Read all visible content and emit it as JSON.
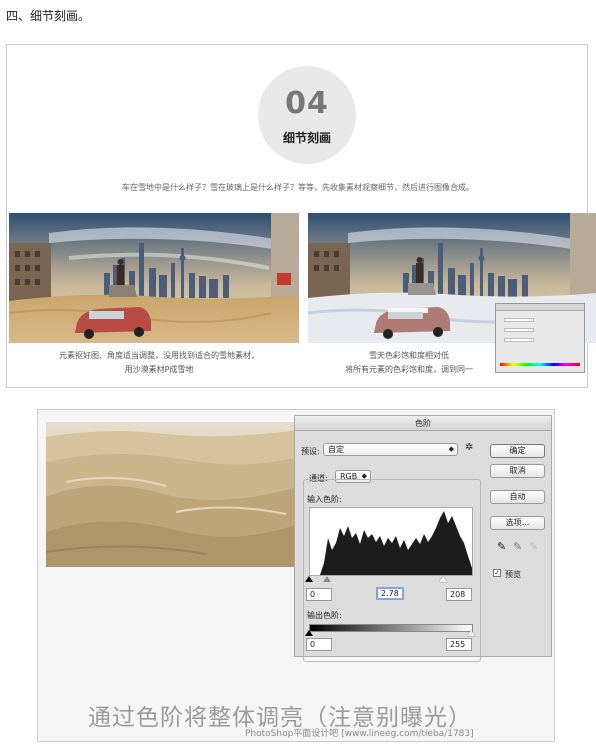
{
  "section_heading": "四、细节刻画。",
  "panel1": {
    "badge_number": "04",
    "badge_title": "细节刻画",
    "intro_text": "车在雪地中是什么样子？雪在玻璃上是什么样子？等等，先收集素材观察细节，然后进行图像合成。",
    "left_caption_line1": "元素抠好图、角度适当调整，没用找到适合的雪地素材，",
    "left_caption_line2": "用沙漠素材P成雪地",
    "right_caption_line1": "雪天色彩饱和度相对低",
    "right_caption_line2": "将所有元素的色彩饱和度，调到同一"
  },
  "levels_dialog": {
    "title": "色阶",
    "preset_label": "预设:",
    "preset_value": "自定",
    "channel_label": "通道:",
    "channel_value": "RGB",
    "input_levels_label": "输入色阶:",
    "input_black": "0",
    "input_gamma": "2.78",
    "input_white": "208",
    "output_levels_label": "输出色阶:",
    "output_black": "0",
    "output_white": "255",
    "ok_button": "确定",
    "cancel_button": "取消",
    "auto_button": "自动",
    "options_button": "选项...",
    "preview_label": "预览",
    "preview_checked": true
  },
  "panel2": {
    "caption": "通过色阶将整体调亮（注意别曝光）",
    "watermark": "PhotoShop平面设计吧 [www.lineeg.com/tieba/1783]"
  }
}
